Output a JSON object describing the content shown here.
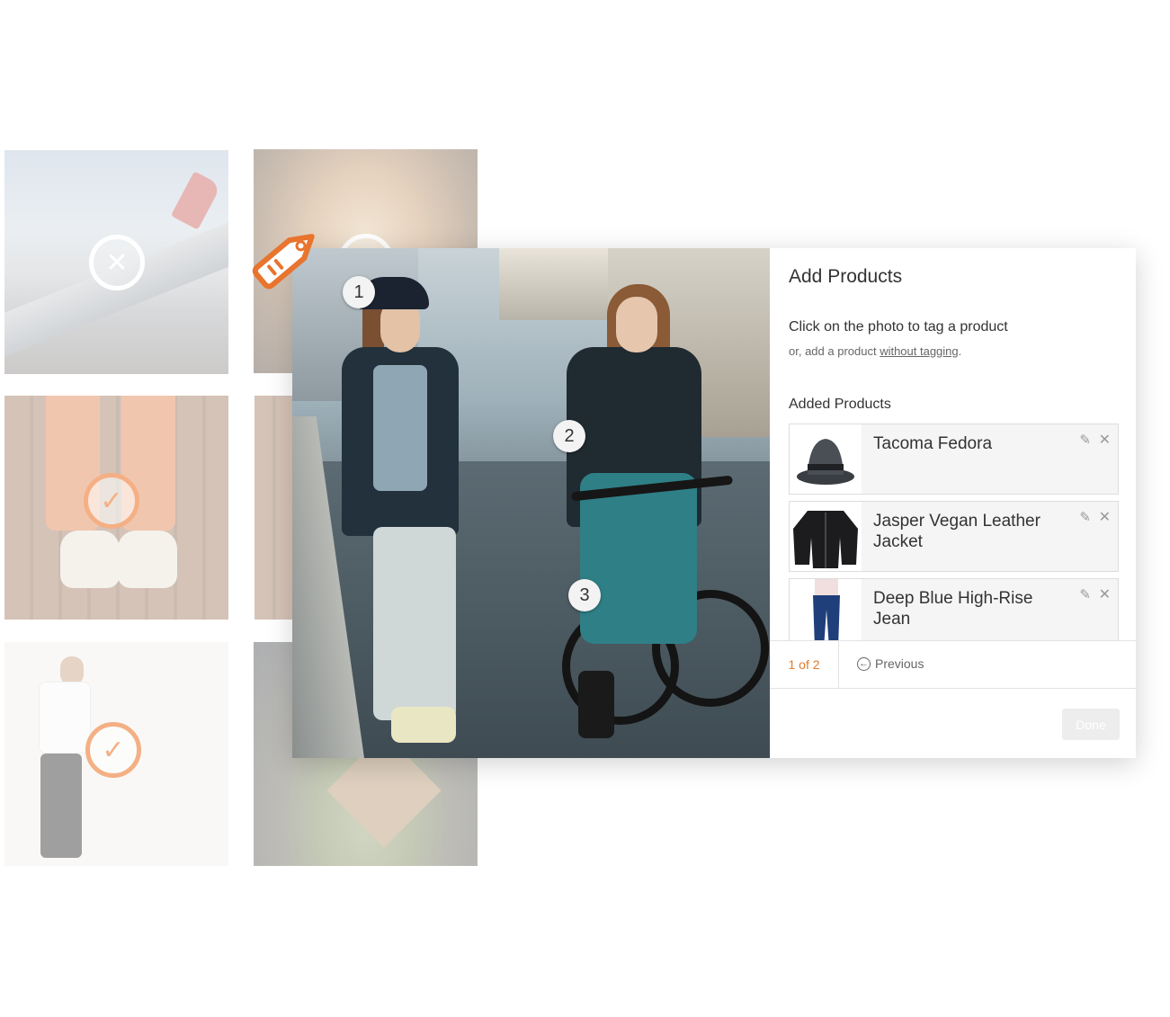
{
  "grid": {
    "tiles": [
      {
        "subject": "airplane wing",
        "status": "x"
      },
      {
        "subject": "woman portrait",
        "status": "x"
      },
      {
        "subject": "orange pants and sneakers",
        "status": "check"
      },
      {
        "subject": "man in white shirt",
        "status": "check"
      },
      {
        "subject": "baseball stadium",
        "status": "x"
      }
    ],
    "icons": {
      "x": "✕",
      "check": "✓"
    }
  },
  "colors": {
    "accent": "#e8742e",
    "check": "#f4b084",
    "muted": "#999999"
  },
  "photo": {
    "markers": [
      "1",
      "2",
      "3"
    ]
  },
  "panel": {
    "title": "Add Products",
    "instruction": "Click on the photo to tag a product",
    "sub_prefix": "or, add a product ",
    "sub_link": "without tagging",
    "sub_suffix": ".",
    "section_title": "Added Products",
    "products": [
      {
        "name": "Tacoma Fedora",
        "icon": "fedora-hat"
      },
      {
        "name": "Jasper Vegan Leather Jacket",
        "icon": "leather-jacket"
      },
      {
        "name": "Deep Blue High-Rise Jean",
        "icon": "jeans"
      }
    ],
    "actions": {
      "edit": "pencil-icon",
      "remove": "close-icon"
    }
  },
  "pager": {
    "count": "1 of 2",
    "previous_label": "Previous"
  },
  "done_label": "Done"
}
